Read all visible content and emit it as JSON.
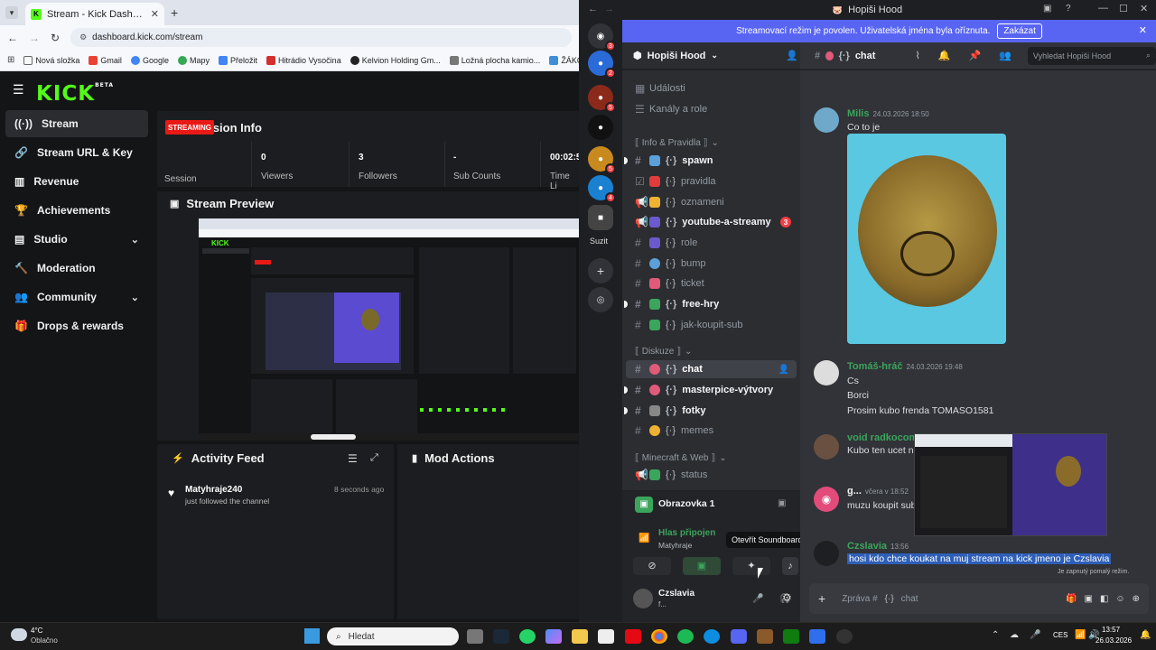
{
  "browser": {
    "tab_title": "Stream - Kick Dashboard",
    "url": "dashboard.kick.com/stream",
    "bookmarks": [
      "Nová složka",
      "Gmail",
      "Google",
      "Mapy",
      "Přeložit",
      "Hitrádio Vysočina",
      "Kelvion Holding Gm...",
      "Ložná plocha kamio...",
      "ŽÁKOVS"
    ]
  },
  "kick": {
    "logo": "KICK",
    "logo_sup": "BETA",
    "nav": [
      "Stream",
      "Stream URL & Key",
      "Revenue",
      "Achievements",
      "Studio",
      "Moderation",
      "Community",
      "Drops & rewards"
    ],
    "session_title": "Session Info",
    "streaming_badge": "STREAMING",
    "session_label": "Session",
    "stats": [
      {
        "value": "0",
        "label": "Viewers"
      },
      {
        "value": "3",
        "label": "Followers"
      },
      {
        "value": "-",
        "label": "Sub Counts"
      },
      {
        "value": "00:02:5",
        "label": "Time Li"
      }
    ],
    "preview_title": "Stream Preview",
    "activity_title": "Activity Feed",
    "activity": {
      "user": "Matyhraje240",
      "action": "just followed the channel",
      "time": "8 seconds ago"
    },
    "mod_title": "Mod Actions"
  },
  "discord": {
    "window_title": "Hopiši Hood",
    "banner_text": "Streamovací režim je povolen. Uživatelská jména byla oříznuta.",
    "banner_button": "Zakázat",
    "server_name": "Hopiši Hood",
    "current_channel": "chat",
    "search_placeholder": "Vyhledat Hopiši Hood",
    "events": "Události",
    "channels_roles": "Kanály a role",
    "cat_info": "⟦ Info & Pravidla ⟧",
    "cat_diskuze": "⟦ Diskuze ⟧",
    "cat_mc": "⟦ Minecraft & Web ⟧",
    "info_channels": [
      "spawn",
      "pravidla",
      "oznameni",
      "youtube-a-streamy",
      "role",
      "bump",
      "ticket",
      "free-hry",
      "jak-koupit-sub"
    ],
    "youtube_badge": "3",
    "diskuze_channels": [
      "chat",
      "masterpice-výtvory",
      "fotky",
      "memes"
    ],
    "mc_channels": [
      "status"
    ],
    "screen_share": "Obrazovka 1",
    "voice_status": "Hlas připojen",
    "voice_channel": "Matyhraje",
    "tooltip": "Otevřít Soundboard",
    "user_name": "Czslavia",
    "user_status": "f...",
    "rail_label": "Suzit",
    "messages": [
      {
        "name": "Milis",
        "time": "24.03.2026 18:50",
        "lines": [
          "Co to je"
        ],
        "color": "#3ba55c"
      },
      {
        "name": "Tomáš-hráč",
        "time": "24.03.2026 19:48",
        "lines": [
          "Cs",
          "Borci",
          "Prosim kubo frenda TOMASO1581"
        ],
        "color": "#3ba55c"
      },
      {
        "name": "void radkocom",
        "time": "",
        "lines": [
          "Kubo ten ucet n"
        ],
        "color": "#3ba55c"
      },
      {
        "name": "g...",
        "time": "včera v 18:52",
        "lines": [
          "muzu koupit sub"
        ],
        "color": "#f2f3f5"
      },
      {
        "name": "Czslavia",
        "time": "13:56",
        "lines": [
          "hosi kdo chce koukat na muj stream na kick jmeno je Czslavia"
        ],
        "color": "#3ba55c"
      }
    ],
    "slow_mode": "Je zapnutý pomalý režim.",
    "composer_placeholder": "Zpráva #",
    "composer_channel": "chat"
  },
  "taskbar": {
    "weather_temp": "4°C",
    "weather_desc": "Oblačno",
    "search": "Hledat",
    "lang": "CES",
    "time": "13:57",
    "date": "26.03.2026"
  }
}
